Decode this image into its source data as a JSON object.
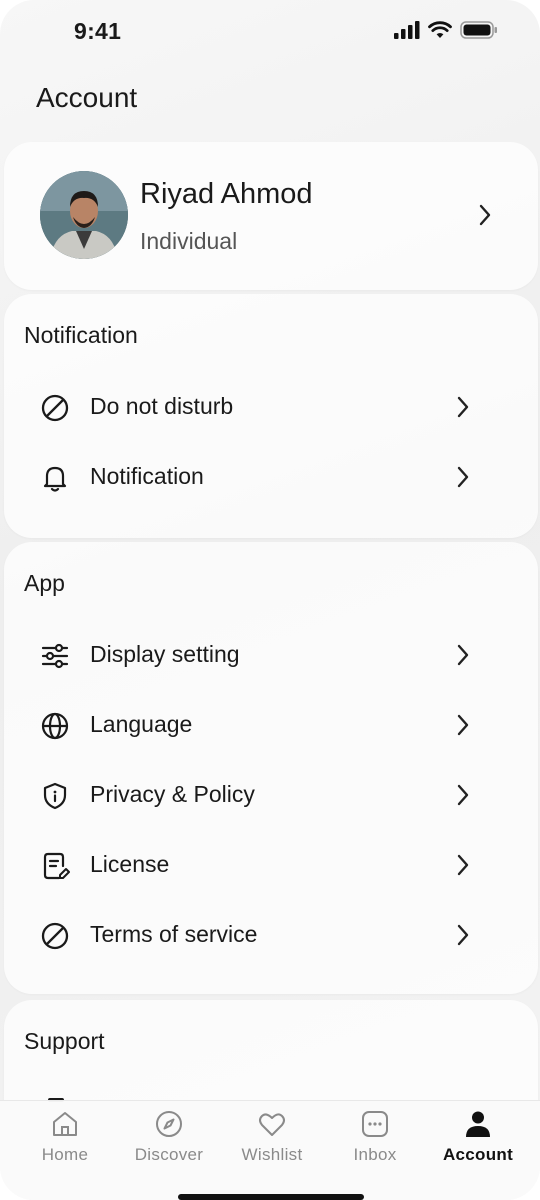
{
  "status": {
    "time": "9:41"
  },
  "page": {
    "title": "Account"
  },
  "profile": {
    "name": "Riyad Ahmod",
    "type": "Individual"
  },
  "sections": {
    "notification": {
      "title": "Notification",
      "items": [
        {
          "label": "Do not disturb",
          "icon": "do-not-disturb-icon"
        },
        {
          "label": "Notification",
          "icon": "bell-icon"
        }
      ]
    },
    "app": {
      "title": "App",
      "items": [
        {
          "label": "Display setting",
          "icon": "sliders-icon"
        },
        {
          "label": "Language",
          "icon": "globe-icon"
        },
        {
          "label": "Privacy & Policy",
          "icon": "shield-icon"
        },
        {
          "label": "License",
          "icon": "document-edit-icon"
        },
        {
          "label": "Terms of service",
          "icon": "prohibited-icon"
        }
      ]
    },
    "support": {
      "title": "Support"
    }
  },
  "tabs": [
    {
      "label": "Home",
      "icon": "home-icon",
      "active": false
    },
    {
      "label": "Discover",
      "icon": "compass-icon",
      "active": false
    },
    {
      "label": "Wishlist",
      "icon": "heart-icon",
      "active": false
    },
    {
      "label": "Inbox",
      "icon": "inbox-icon",
      "active": false
    },
    {
      "label": "Account",
      "icon": "person-icon",
      "active": true
    }
  ],
  "colors": {
    "text": "#1a1a1a",
    "muted": "#8a8a8a",
    "active_tab": "#111111"
  }
}
